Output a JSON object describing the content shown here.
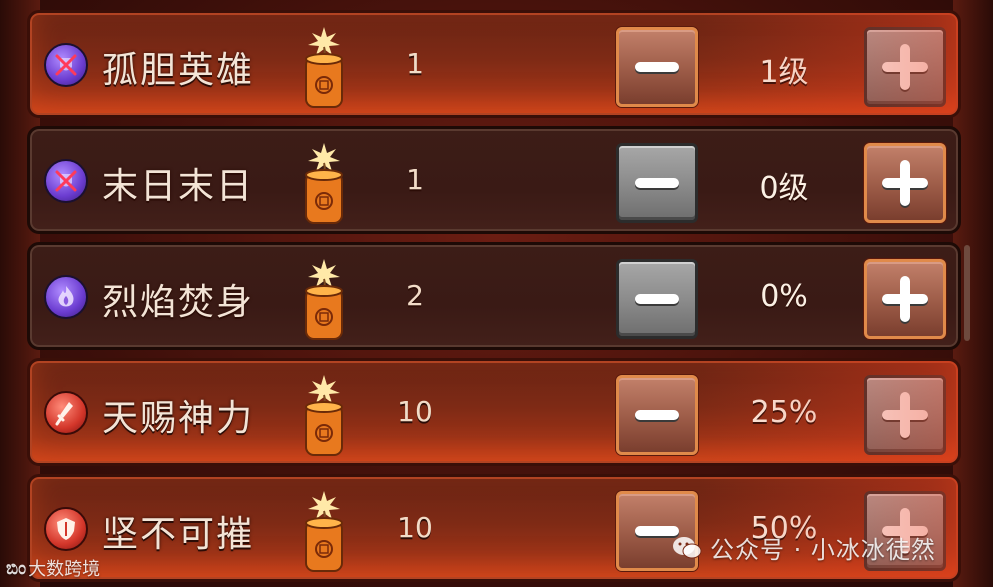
{
  "skills": [
    {
      "name": "孤胆英雄",
      "icon": "purple-crossed-shield-icon",
      "cost": "1",
      "level": "1级",
      "active": true,
      "minus_style": "brown",
      "plus_style": "gray"
    },
    {
      "name": "末日末日",
      "icon": "purple-crossed-shield-icon",
      "cost": "1",
      "level": "0级",
      "active": false,
      "minus_style": "gray",
      "plus_style": "brown"
    },
    {
      "name": "烈焰焚身",
      "icon": "purple-flame-icon",
      "cost": "2",
      "level": "0%",
      "active": false,
      "minus_style": "gray",
      "plus_style": "brown"
    },
    {
      "name": "天赐神力",
      "icon": "red-sword-icon",
      "cost": "10",
      "level": "25%",
      "active": true,
      "minus_style": "brown",
      "plus_style": "gray"
    },
    {
      "name": "坚不可摧",
      "icon": "red-shield-icon",
      "cost": "10",
      "level": "50%",
      "active": true,
      "minus_style": "brown",
      "plus_style": "gray"
    }
  ],
  "watermark": {
    "text": "公众号 · 小冰冰徒然",
    "icon": "wechat-icon"
  },
  "logo": {
    "mark": "ಬಿಂ",
    "text": "大数跨境"
  },
  "colors": {
    "active_row": "#9a3217",
    "inactive_row": "#3a1a15",
    "gray_button": "#8c8c8c",
    "brown_button": "#9c5b47"
  }
}
